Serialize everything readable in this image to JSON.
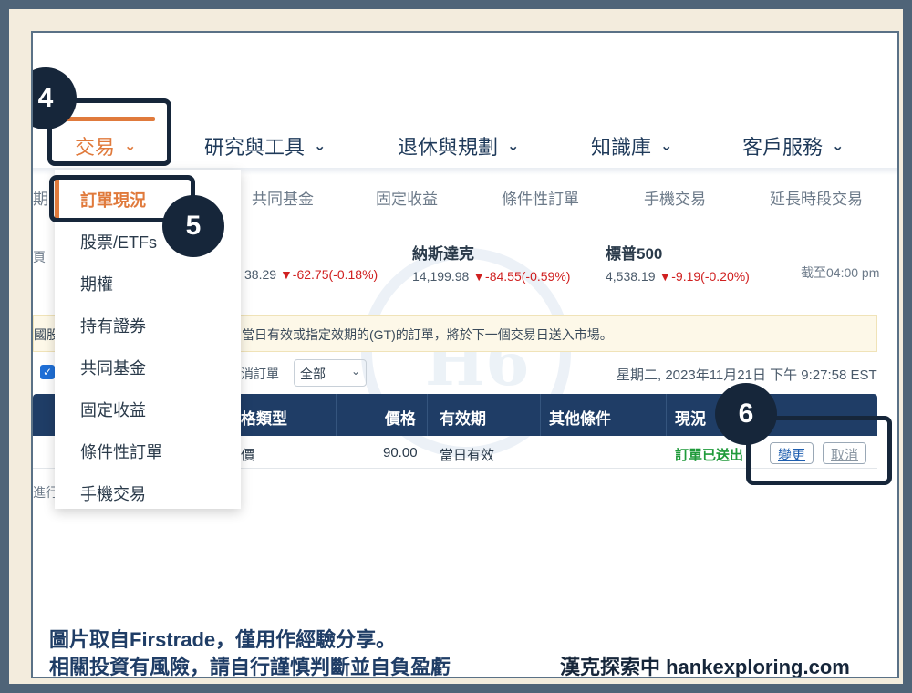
{
  "top_nav": {
    "trade": "交易",
    "research": "研究與工具",
    "retirement": "退休與規劃",
    "knowledge": "知識庫",
    "service": "客戶服務"
  },
  "sub_nav": [
    "期",
    "共同基金",
    "固定收益",
    "條件性訂單",
    "手機交易",
    "延長時段交易"
  ],
  "left_cut": {
    "page": "頁",
    "notice": "國股",
    "progress": "進行"
  },
  "market": [
    {
      "name": "",
      "value": "38.29",
      "change": "▼-62.75(-0.18%)"
    },
    {
      "name": "納斯達克",
      "value": "14,199.98",
      "change": "▼-84.55(-0.59%)"
    },
    {
      "name": "標普500",
      "value": "4,538.19",
      "change": "▼-9.19(-0.20%)"
    }
  ],
  "as_of": "截至04:00 pm",
  "notice": "當日有效或指定效期的(GT)的訂單，將於下一個交易日送入市場。",
  "filter": {
    "label": "消訂單",
    "select_value": "全部",
    "datetime": "星期二, 2023年11月21日 下午 9:27:58 EST"
  },
  "table": {
    "headers": [
      "格類型",
      "價格",
      "有效期",
      "其他條件",
      "現況"
    ],
    "row": {
      "type": "價",
      "price": "90.00",
      "validity": "當日有效",
      "other": "",
      "status": "訂單已送出",
      "change_btn": "變更",
      "cancel_btn": "取消"
    }
  },
  "dropdown": [
    "訂單現況",
    "股票/ETFs",
    "期權",
    "持有證券",
    "共同基金",
    "固定收益",
    "條件性訂單",
    "手機交易"
  ],
  "callouts": [
    "4",
    "5",
    "6"
  ],
  "watermark": "H6",
  "footer": {
    "line1": "圖片取自Firstrade，僅用作經驗分享。",
    "line2": "相關投資有風險，請自行謹慎判斷並自負盈虧",
    "brand": "漢克探索中 hankexploring.com"
  },
  "colors": {
    "accent": "#e07a3c",
    "navy": "#1f3d66",
    "down": "#d02020",
    "ok": "#1f9a3a"
  }
}
